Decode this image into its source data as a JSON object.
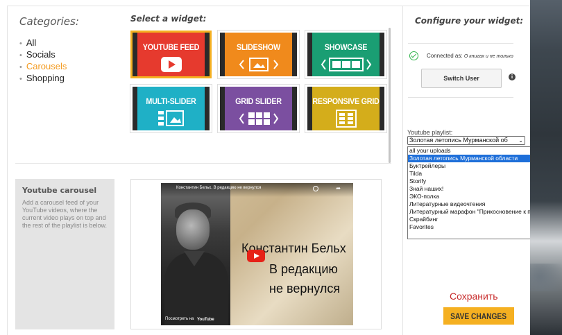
{
  "categories": {
    "title": "Categories:",
    "items": [
      {
        "label": "All",
        "active": false
      },
      {
        "label": "Socials",
        "active": false
      },
      {
        "label": "Carousels",
        "active": true
      },
      {
        "label": "Shopping",
        "active": false
      }
    ]
  },
  "widgets": {
    "title": "Select a widget:",
    "tiles": [
      {
        "label": "YOUTUBE FEED",
        "color": "#e63a2e",
        "selected": true,
        "icon": "youtube-play-icon"
      },
      {
        "label": "SLIDESHOW",
        "color": "#f08a1c",
        "selected": false,
        "icon": "slideshow-icon"
      },
      {
        "label": "SHOWCASE",
        "color": "#1a9e73",
        "selected": false,
        "icon": "showcase-icon"
      },
      {
        "label": "MULTI-SLIDER",
        "color": "#1fb0c6",
        "selected": false,
        "icon": "multi-slider-icon"
      },
      {
        "label": "GRID SLIDER",
        "color": "#7b4fa0",
        "selected": false,
        "icon": "grid-slider-icon"
      },
      {
        "label": "RESPONSIVE GRID",
        "color": "#d4ad1b",
        "selected": false,
        "icon": "responsive-grid-icon"
      }
    ]
  },
  "preview": {
    "desc_title": "Youtube carousel",
    "desc_text": "Add a carousel feed of your YouTube videos, where the current video plays on top and the rest of the playlist is below.",
    "video": {
      "top_title": "Константин Бельх. В редакцию не вернулся",
      "line1": "Константин Бельх",
      "line2": "В редакцию",
      "line3": "не вернулся",
      "watch_on": "Посмотреть на",
      "yt_logo": "YouTube"
    }
  },
  "config": {
    "title": "Configure your widget:",
    "connected_label": "Connected as:",
    "connected_user": "О книгах и не только",
    "switch_user": "Switch User",
    "info_glyph": "i",
    "playlist_label": "Youtube playlist:",
    "playlist_selected": "Золотая летопись Мурманской об",
    "playlist_options": [
      "all your uploads",
      "Золотая летопись Мурманской области",
      "Буктрейлеры",
      "Tilda",
      "Storify",
      "Знай наших!",
      "ЭКО-полка",
      "Литературные видеочтения",
      "Литературный марафон \"Прикосновение к подвигу\"",
      "Скрайбинг",
      "Favorites"
    ],
    "playlist_highlight_index": 1,
    "save_text": "Сохранить",
    "save_button": "SAVE CHANGES",
    "accent": "#f5b021"
  }
}
